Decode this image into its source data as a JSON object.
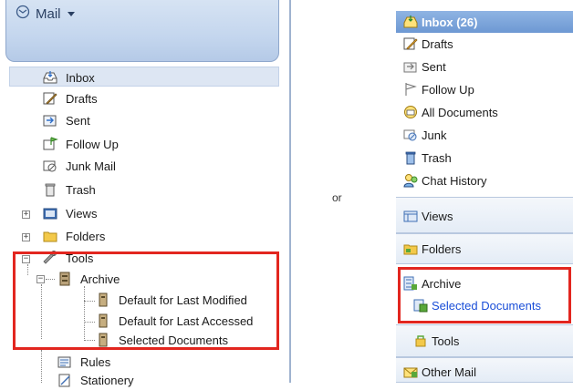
{
  "left_panel": {
    "header": {
      "title": "Mail",
      "dropdown_icon": "caret-down-icon"
    },
    "tree": [
      {
        "label": "Inbox",
        "icon": "inbox-icon"
      },
      {
        "label": "Drafts",
        "icon": "drafts-icon"
      },
      {
        "label": "Sent",
        "icon": "sent-icon"
      },
      {
        "label": "Follow Up",
        "icon": "follow-up-icon"
      },
      {
        "label": "Junk Mail",
        "icon": "junk-mail-icon"
      },
      {
        "label": "Trash",
        "icon": "trash-icon"
      },
      {
        "label": "Views",
        "icon": "views-icon",
        "expander": "+"
      },
      {
        "label": "Folders",
        "icon": "folder-icon",
        "expander": "+"
      },
      {
        "label": "Tools",
        "icon": "tools-icon",
        "expander": "−"
      },
      {
        "label": "Archive",
        "icon": "archive-icon",
        "expander": "−"
      },
      {
        "label": "Default for Last Modified",
        "icon": "archive-doc-icon"
      },
      {
        "label": "Default for Last Accessed",
        "icon": "archive-doc-icon"
      },
      {
        "label": "Selected Documents",
        "icon": "archive-doc-icon"
      },
      {
        "label": "Rules",
        "icon": "rules-icon"
      },
      {
        "label": "Stationery",
        "icon": "stationery-icon"
      }
    ]
  },
  "middle": {
    "or_text": "or"
  },
  "right_panel": {
    "items": [
      {
        "label": "Inbox (26)",
        "icon": "inbox-icon"
      },
      {
        "label": "Drafts",
        "icon": "drafts-icon"
      },
      {
        "label": "Sent",
        "icon": "sent-icon"
      },
      {
        "label": "Follow Up",
        "icon": "follow-up-icon"
      },
      {
        "label": "All Documents",
        "icon": "all-documents-icon"
      },
      {
        "label": "Junk",
        "icon": "junk-icon"
      },
      {
        "label": "Trash",
        "icon": "trash-icon"
      },
      {
        "label": "Chat History",
        "icon": "chat-history-icon"
      },
      {
        "label": "Views",
        "icon": "views-icon"
      },
      {
        "label": "Folders",
        "icon": "folders-icon"
      },
      {
        "label": "Archive",
        "icon": "archive-icon"
      },
      {
        "label": "Selected Documents",
        "icon": "selected-docs-icon"
      },
      {
        "label": "Tools",
        "icon": "tools-icon"
      },
      {
        "label": "Other Mail",
        "icon": "other-mail-icon"
      }
    ]
  },
  "colors": {
    "highlight_red": "#e2261f",
    "header_blue": "#c4d6ee",
    "inbox_selected_blue": "#7ba3d9",
    "link_blue": "#1a4ed8"
  }
}
